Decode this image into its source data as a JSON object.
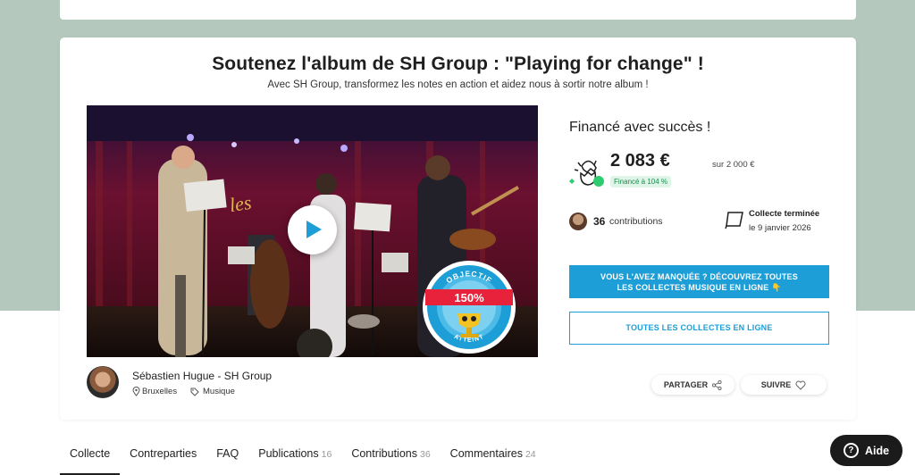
{
  "project": {
    "title": "Soutenez l'album de SH Group : \"Playing for change\" !",
    "subtitle": "Avec SH Group, transformez les notes en action et aidez nous à sortir notre album !"
  },
  "media": {
    "badge_top": "OBJECTIF",
    "badge_pct": "150%",
    "badge_bottom": "ATTEINT",
    "play_icon": "play-icon"
  },
  "funding": {
    "status": "Financé avec succès !",
    "amount": "2 083 €",
    "goal": "sur 2 000 €",
    "percent": "Financé à 104 %",
    "contributions_count": "36",
    "contributions_label": "contributions",
    "end_title": "Collecte terminée",
    "end_date": "le 9 janvier 2026"
  },
  "buttons": {
    "missed_line1": "VOUS L'AVEZ MANQUÉE ? DÉCOUVREZ TOUTES",
    "missed_line2": "LES COLLECTES MUSIQUE EN LIGNE 👇",
    "all_collections": "TOUTES LES COLLECTES EN LIGNE",
    "share": "PARTAGER",
    "follow": "SUIVRE"
  },
  "author": {
    "name": "Sébastien Hugue - SH Group",
    "location": "Bruxelles",
    "category": "Musique"
  },
  "tabs": [
    {
      "label": "Collecte",
      "count": ""
    },
    {
      "label": "Contreparties",
      "count": ""
    },
    {
      "label": "FAQ",
      "count": ""
    },
    {
      "label": "Publications",
      "count": "16"
    },
    {
      "label": "Contributions",
      "count": "36"
    },
    {
      "label": "Commentaires",
      "count": "24"
    }
  ],
  "help": {
    "label": "Aide",
    "icon": "?"
  },
  "colors": {
    "accent": "#1e9ed6",
    "background_top": "#b4c8bd",
    "success_bg": "#dff5e8",
    "success_text": "#1d8a4e"
  }
}
